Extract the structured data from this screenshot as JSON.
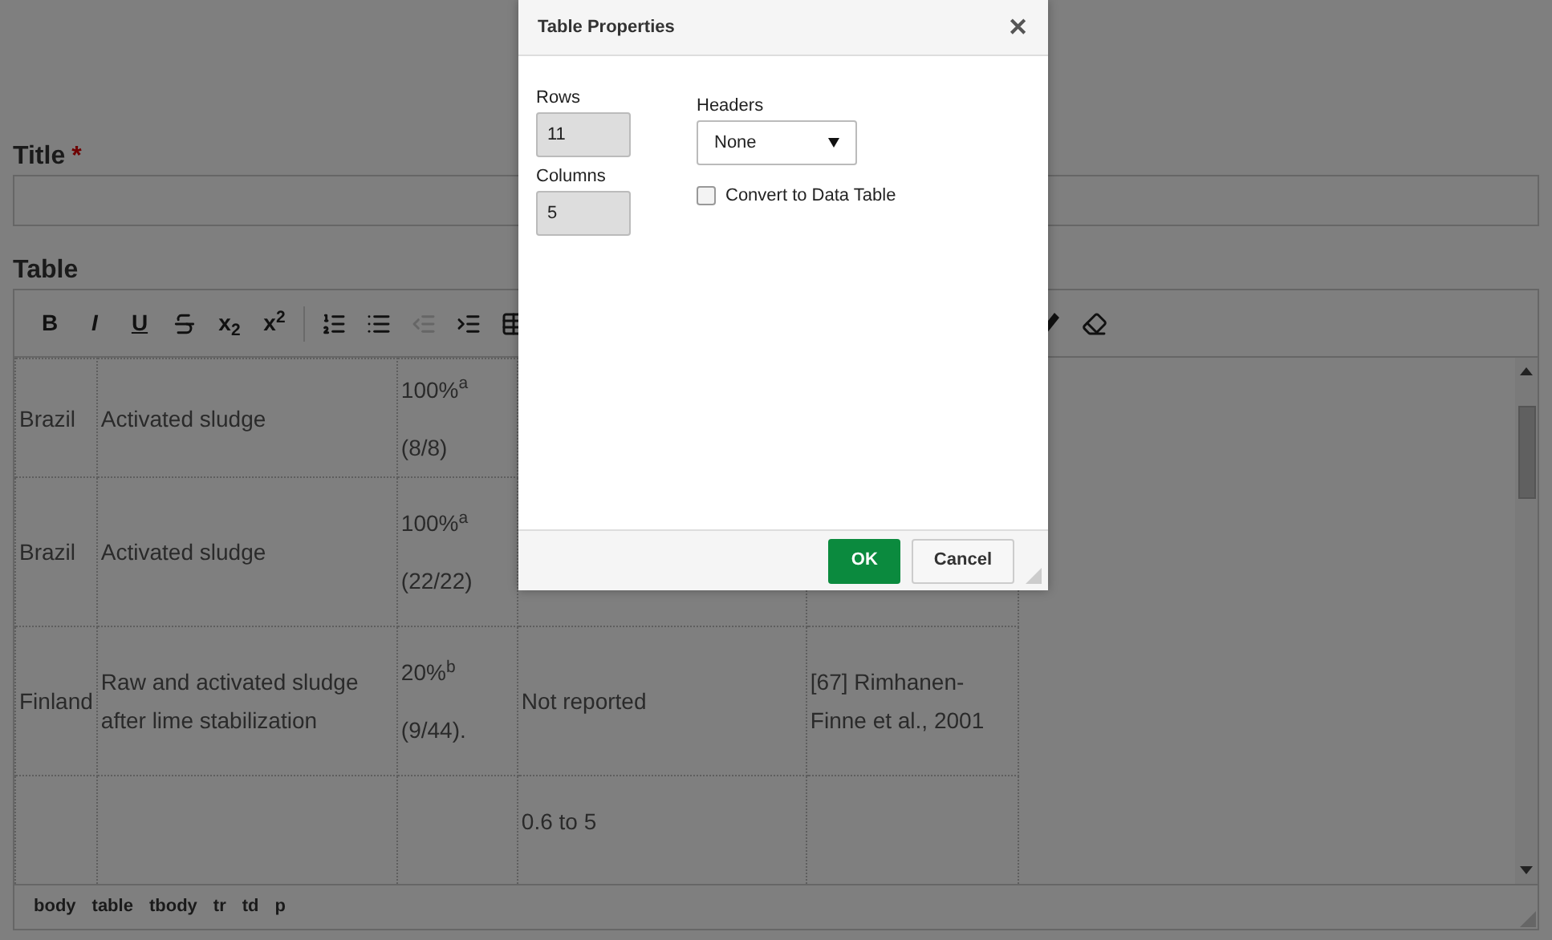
{
  "form": {
    "title_label": "Title",
    "required_mark": "*",
    "table_label": "Table"
  },
  "toolbar": [
    {
      "kind": "bold",
      "label": "B",
      "disabled": false
    },
    {
      "kind": "italic",
      "label": "I",
      "disabled": false
    },
    {
      "kind": "underline",
      "label": "U",
      "disabled": false
    },
    {
      "kind": "strikethrough",
      "disabled": false
    },
    {
      "kind": "bold",
      "label": "x$_{2}$",
      "disabled": false
    },
    {
      "kind": "bold",
      "label": "x$^{2}$",
      "disabled": false
    },
    {
      "kind": "separator"
    },
    {
      "kind": "ordered-list",
      "disabled": false
    },
    {
      "kind": "bullet-list",
      "disabled": false
    },
    {
      "kind": "outdent",
      "disabled": true
    },
    {
      "kind": "indent",
      "disabled": false
    },
    {
      "kind": "table",
      "disabled": false
    },
    {
      "kind": "gap"
    },
    {
      "kind": "pencil",
      "disabled": false
    },
    {
      "kind": "eraser",
      "disabled": false
    }
  ],
  "table_rows": [
    {
      "column_1": [
        "Brazil"
      ],
      "column_2": [
        "Activated sludge"
      ],
      "column_3": [
        "100%$^{a}$",
        "(8/8)"
      ]
    },
    {
      "column_1": [
        "Brazil"
      ],
      "column_2": [
        "Activated sludge"
      ],
      "column_3": [
        "100%$^{a}$",
        "(22/22)"
      ]
    },
    {
      "column_1": [
        "Finland"
      ],
      "column_2": [
        "Raw and activated sludge after lime stabilization"
      ],
      "column_3": [
        "20%$^{b}$",
        "(9/44)."
      ],
      "column_4": [
        "Not reported"
      ],
      "column_5": [
        "[67] Rimhanen-Finne et al., 2001"
      ]
    },
    {
      "column_4": [
        "0.6 to 5"
      ]
    }
  ],
  "path_bar": [
    "body",
    "table",
    "tbody",
    "tr",
    "td",
    "p"
  ],
  "dialog": {
    "title": "Table Properties",
    "close": "✕",
    "rows": {
      "label": "Rows",
      "value": "11"
    },
    "columns": {
      "label": "Columns",
      "value": "5"
    },
    "headers": {
      "label": "Headers",
      "value": "None"
    },
    "convert": {
      "label": "Convert to Data Table",
      "checked": false
    },
    "buttons": [
      {
        "label": "OK",
        "kind": "primary"
      },
      {
        "label": "Cancel",
        "kind": "secondary"
      }
    ]
  }
}
